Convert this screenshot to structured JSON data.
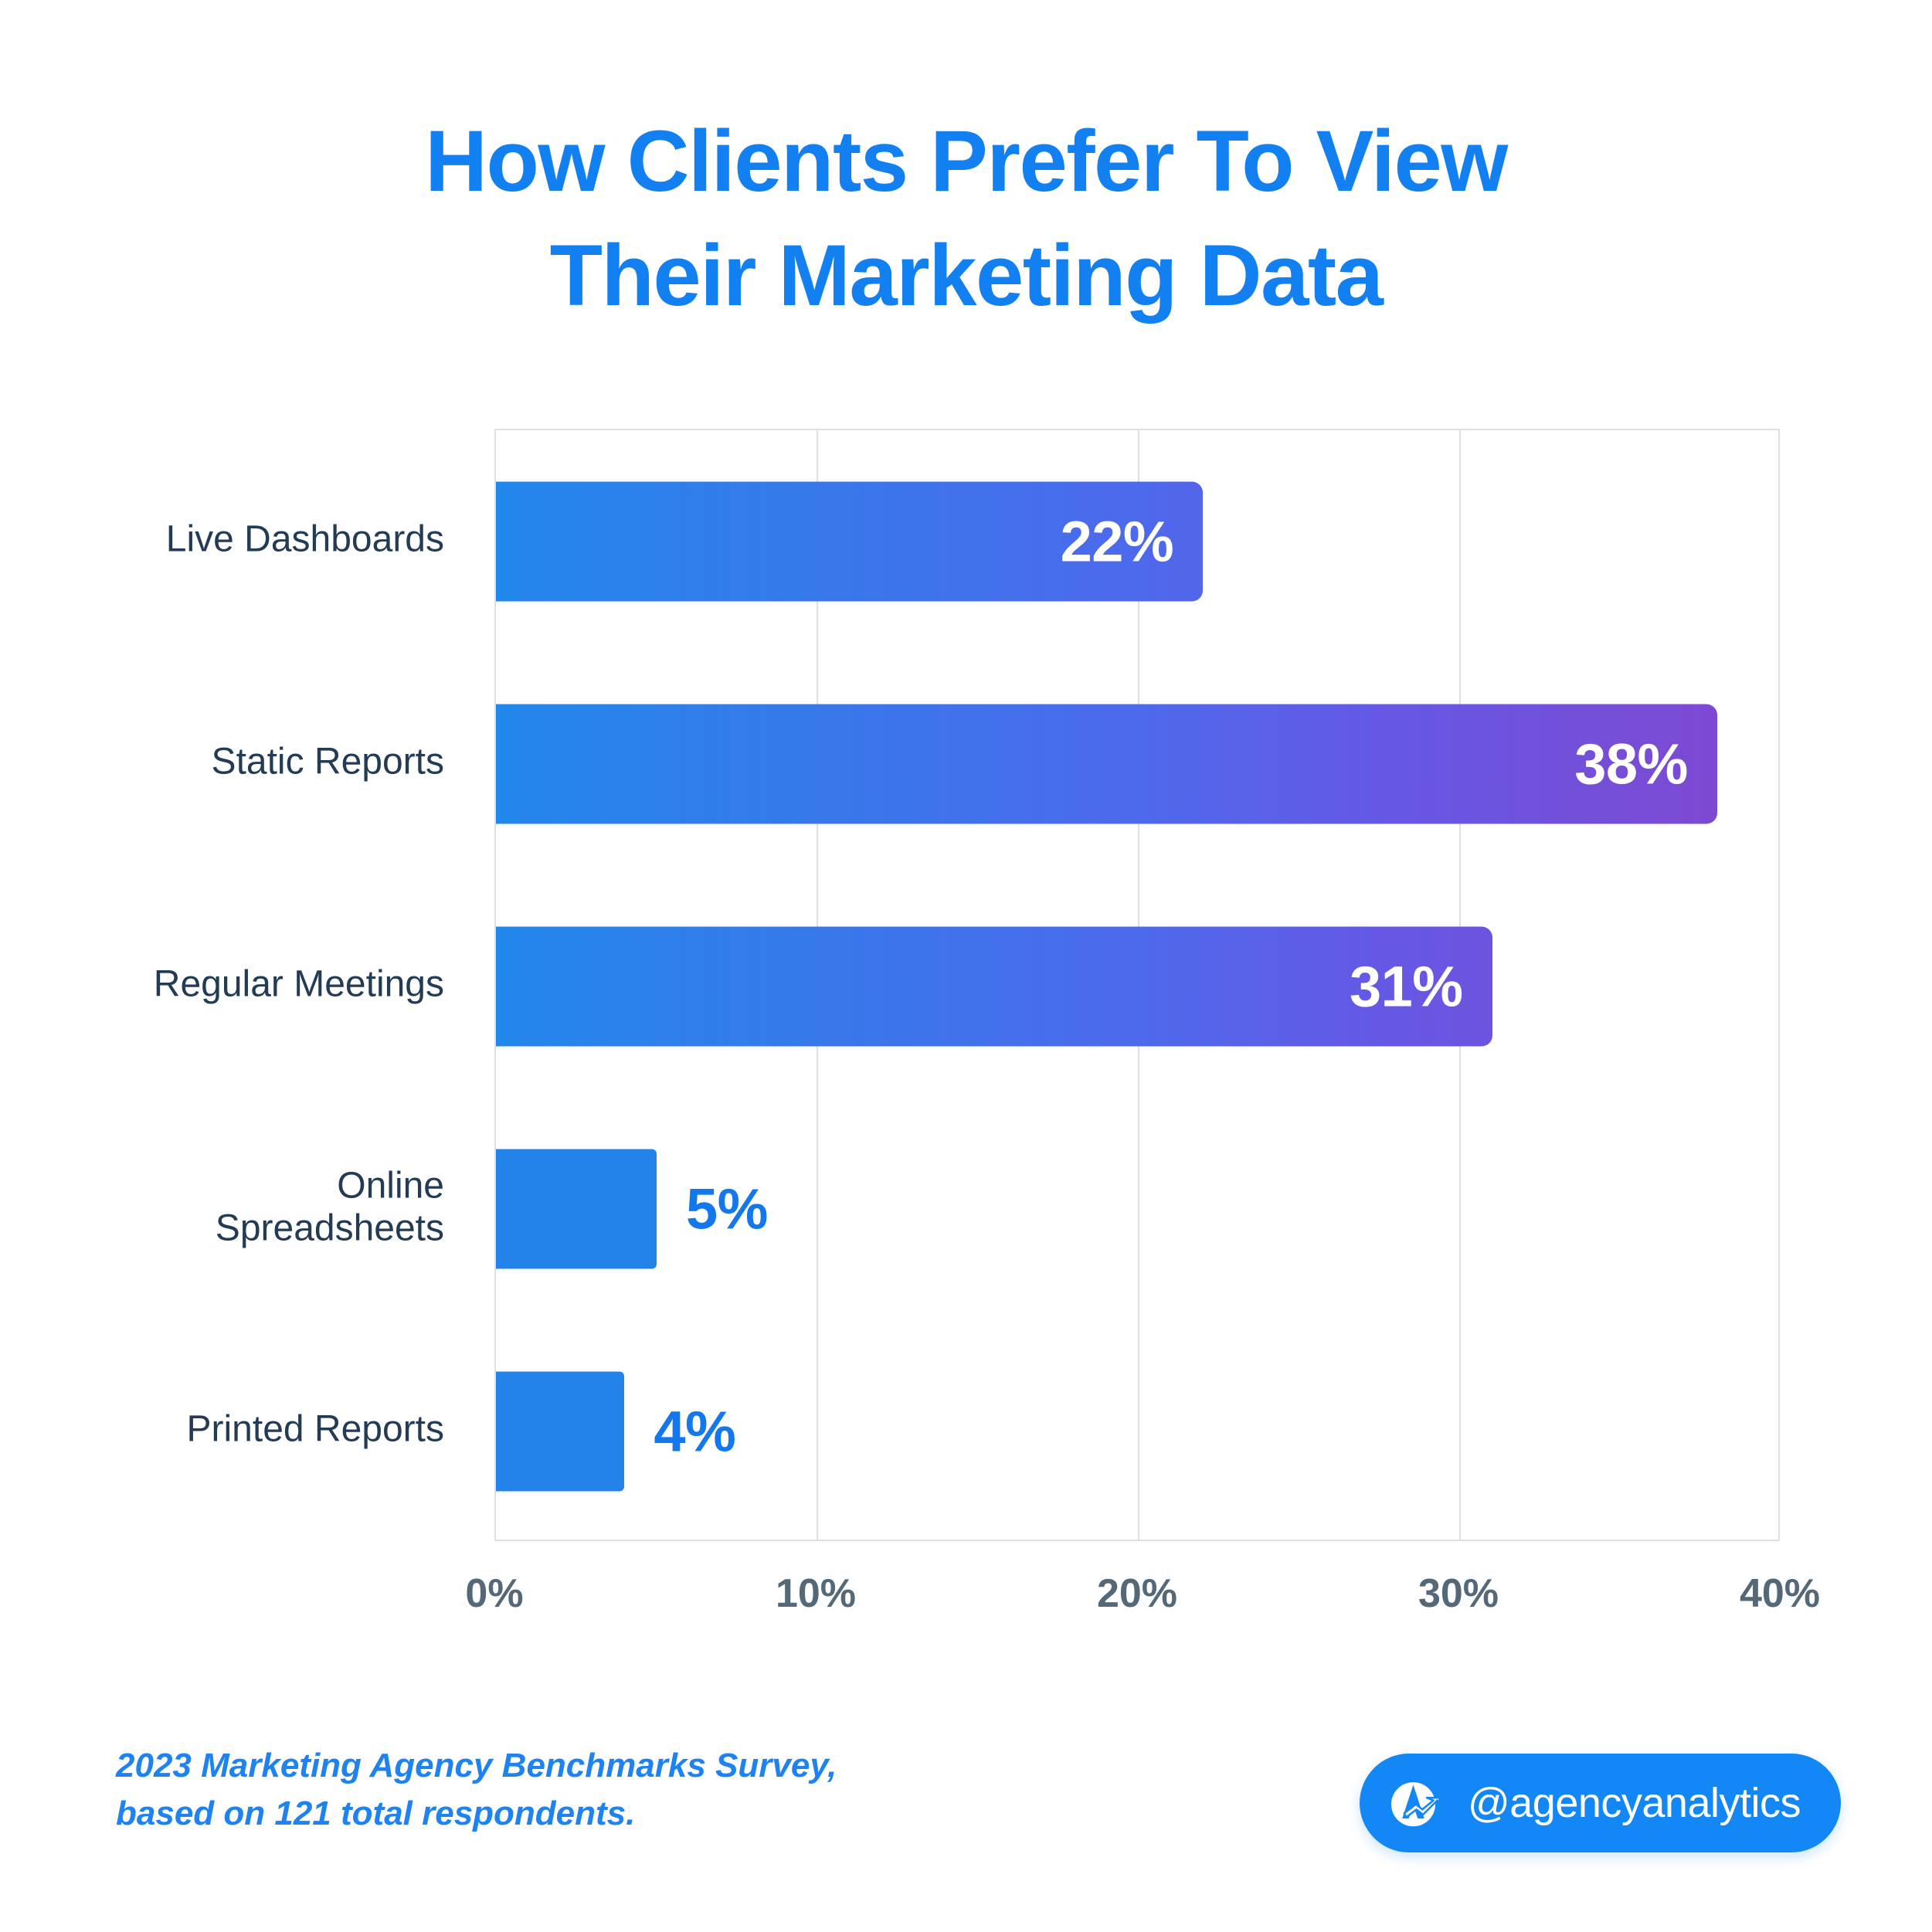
{
  "title": {
    "line1": "How Clients Prefer To View",
    "line2": "Their Marketing Data",
    "color": "#1280F0"
  },
  "chart_data": {
    "type": "bar",
    "orientation": "horizontal",
    "title": "How Clients Prefer To View Their Marketing Data",
    "xlabel": "",
    "ylabel": "",
    "xlim": [
      0,
      40
    ],
    "xticks": [
      "0%",
      "10%",
      "20%",
      "30%",
      "40%"
    ],
    "xtick_values": [
      0,
      10,
      20,
      30,
      40
    ],
    "grid": true,
    "grid_axis": "x",
    "legend": false,
    "categories": [
      "Live Dashboards",
      "Static Reports",
      "Regular Meetings",
      "Online Spreadsheets",
      "Printed Reports"
    ],
    "values": [
      22,
      38,
      31,
      5,
      4
    ],
    "value_labels": [
      "22%",
      "38%",
      "31%",
      "5%",
      "4%"
    ],
    "label_placement": [
      "inside",
      "inside",
      "inside",
      "outside",
      "outside"
    ],
    "bar_style": [
      "gradient",
      "gradient",
      "gradient",
      "solid",
      "solid"
    ],
    "colors": {
      "gradient_start": "#2287EA",
      "gradient_end": "#8246CE",
      "solid": "#2483E8",
      "inside_label": "#FFFFFF",
      "outside_label": "#1378EE",
      "category_label": "#243B55",
      "tick_label": "#546878",
      "grid": "#DCDFE3"
    },
    "bars": [
      {
        "category": "Live Dashboards",
        "label_lines": [
          "Live Dashboards"
        ],
        "value": 22,
        "value_label": "22%",
        "placement": "inside",
        "style": "gradient"
      },
      {
        "category": "Static Reports",
        "label_lines": [
          "Static Reports"
        ],
        "value": 38,
        "value_label": "38%",
        "placement": "inside",
        "style": "gradient"
      },
      {
        "category": "Regular Meetings",
        "label_lines": [
          "Regular Meetings"
        ],
        "value": 31,
        "value_label": "31%",
        "placement": "inside",
        "style": "gradient"
      },
      {
        "category": "Online Spreadsheets",
        "label_lines": [
          "Online",
          "Spreadsheets"
        ],
        "value": 5,
        "value_label": "5%",
        "placement": "outside",
        "style": "solid"
      },
      {
        "category": "Printed Reports",
        "label_lines": [
          "Printed Reports"
        ],
        "value": 4,
        "value_label": "4%",
        "placement": "outside",
        "style": "solid"
      }
    ]
  },
  "footer": {
    "source_line1": "2023 Marketing Agency Benchmarks Survey,",
    "source_line2": "based on 121 total respondents.",
    "badge_handle": "@agencyanalytics",
    "badge_color": "#1287F5"
  }
}
